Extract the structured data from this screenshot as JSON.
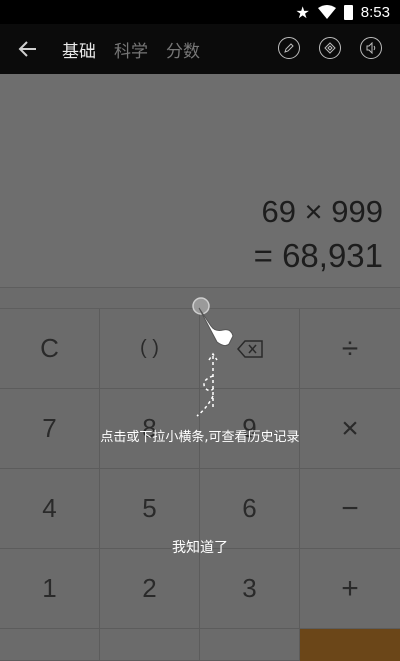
{
  "status": {
    "time": "8:53"
  },
  "appbar": {
    "tabs": [
      {
        "label": "基础",
        "active": true
      },
      {
        "label": "科学",
        "active": false
      },
      {
        "label": "分数",
        "active": false
      }
    ],
    "icons": [
      "back-arrow-icon",
      "pencil-icon",
      "theme-icon",
      "speaker-icon"
    ]
  },
  "display": {
    "expression": "69 × 999",
    "result": "= 68,931"
  },
  "keypad": {
    "rows": [
      [
        "C",
        "( )",
        "⌫",
        "÷"
      ],
      [
        "7",
        "8",
        "9",
        "×"
      ],
      [
        "4",
        "5",
        "6",
        "−"
      ],
      [
        "1",
        "2",
        "3",
        "+"
      ]
    ]
  },
  "guide": {
    "message": "点击或下拉小横条,可查看历史记录",
    "confirm": "我知道了"
  },
  "colors": {
    "accent": "#6b4618",
    "overlay": "#6b6b6b"
  }
}
